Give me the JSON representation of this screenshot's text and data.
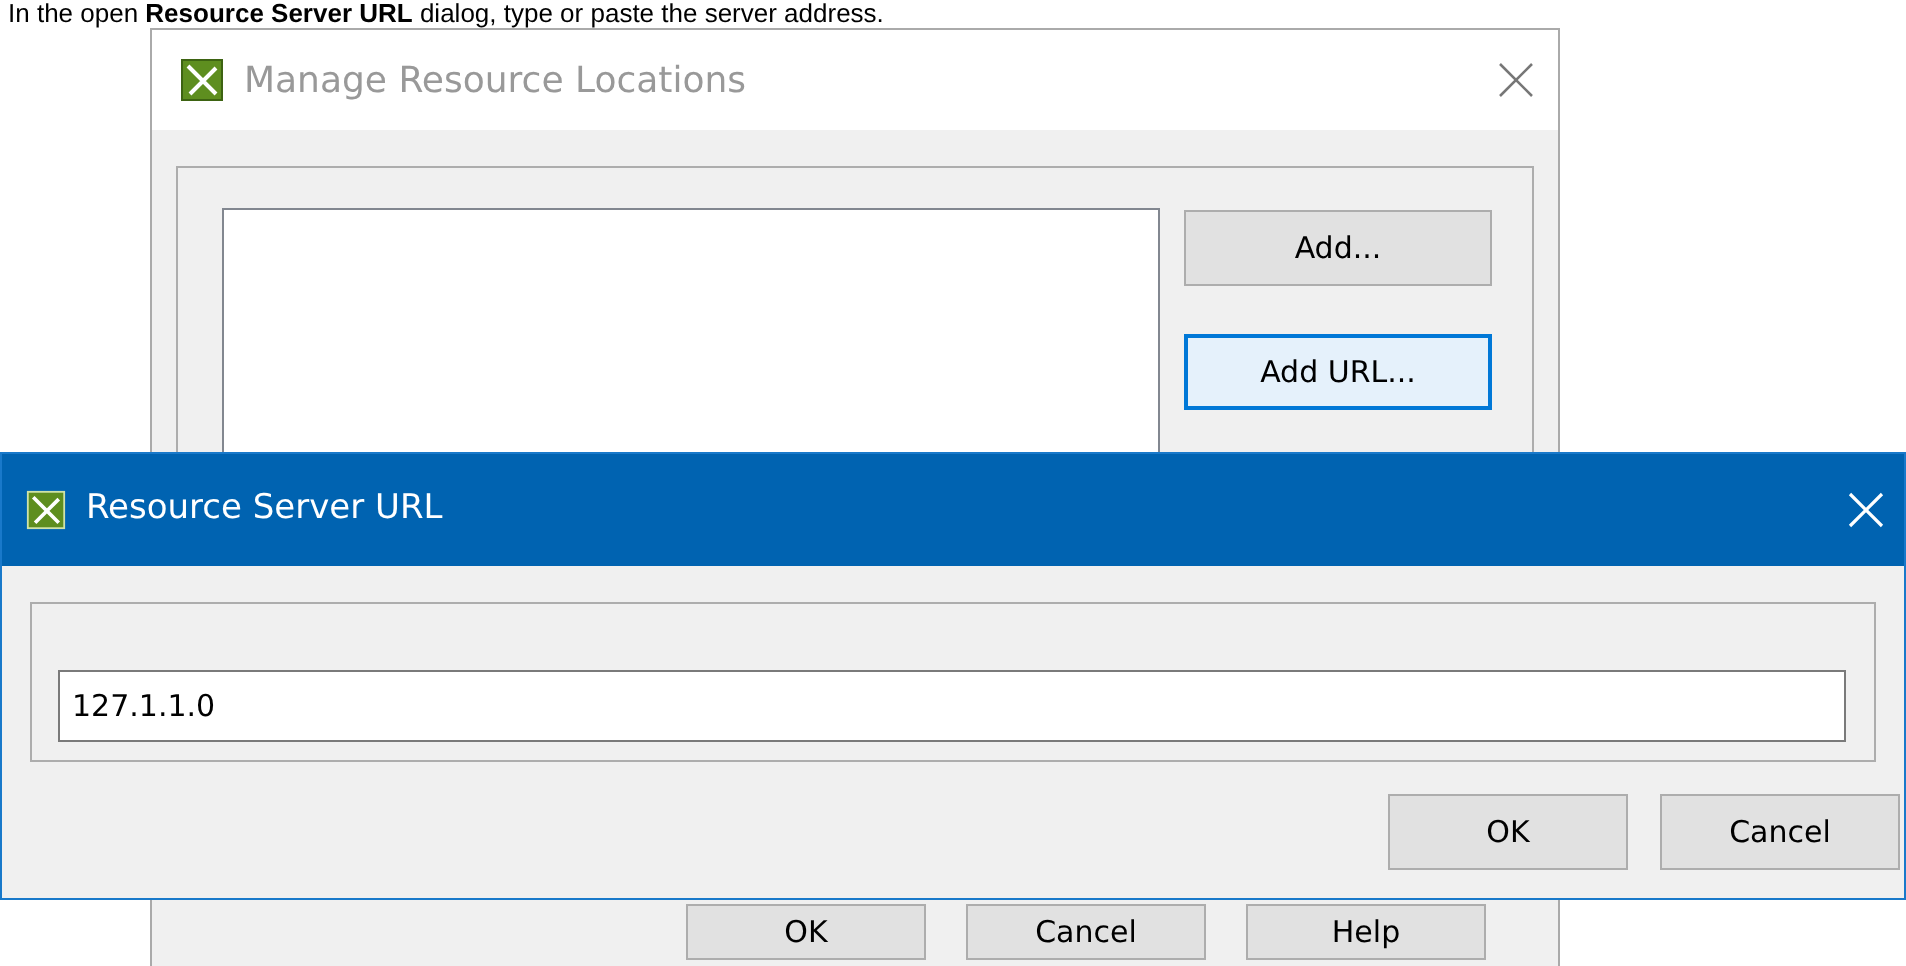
{
  "instruction": "In the open **Resource Server URL** dialog, type or paste the server address.",
  "back_dialog": {
    "title": "Manage Resource Locations",
    "side_buttons": [
      {
        "label": "Add...",
        "focused": false
      },
      {
        "label": "Add URL...",
        "focused": true
      }
    ],
    "buttons": [
      "OK",
      "Cancel",
      "Help"
    ]
  },
  "front_dialog": {
    "title": "Resource Server URL",
    "url_value": "127.1.1.0",
    "buttons": [
      "OK",
      "Cancel"
    ]
  }
}
